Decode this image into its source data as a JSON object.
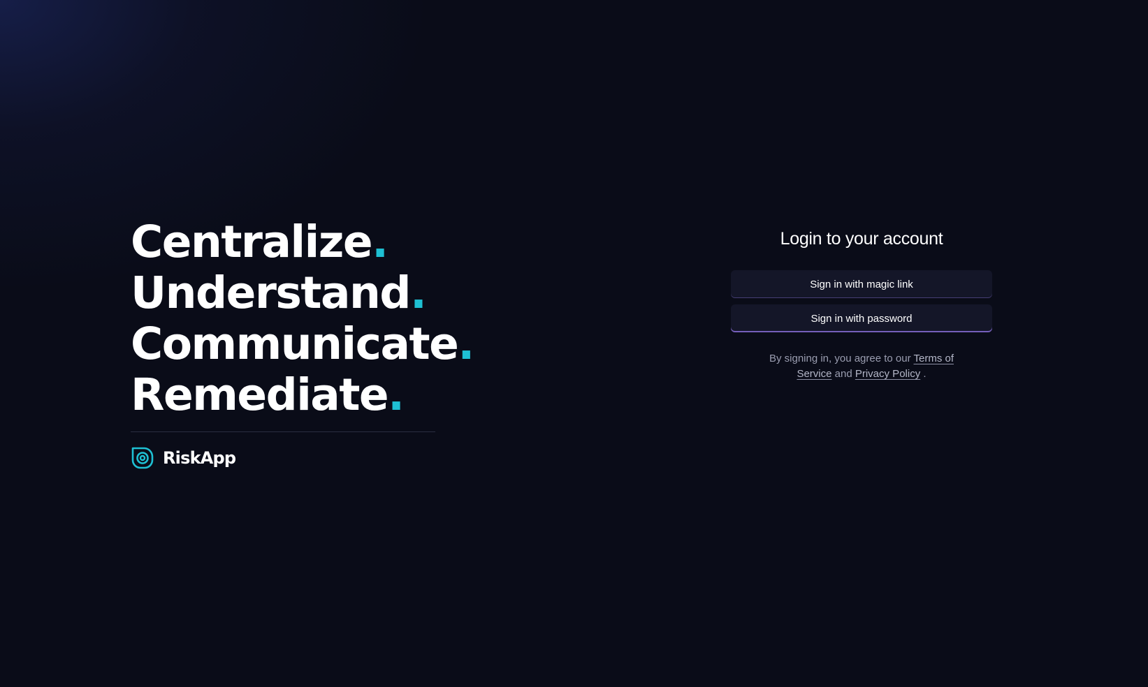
{
  "hero": {
    "lines": [
      {
        "word": "Centralize",
        "dot": "."
      },
      {
        "word": "Understand",
        "dot": "."
      },
      {
        "word": "Communicate",
        "dot": "."
      },
      {
        "word": "Remediate",
        "dot": "."
      }
    ]
  },
  "brand": {
    "name": "RiskApp",
    "logo_icon": "target-logo-icon"
  },
  "login": {
    "title": "Login to your account",
    "magic_link_label": "Sign in with magic link",
    "password_label": "Sign in with password",
    "legal_prefix": "By signing in, you agree to our",
    "terms_label": "Terms of Service",
    "legal_and": "and",
    "privacy_label": "Privacy Policy",
    "legal_suffix": "."
  },
  "colors": {
    "background": "#0a0c18",
    "accent": "#1ec0d3",
    "button_bg": "#141628",
    "button_glow": "#967aeb"
  }
}
